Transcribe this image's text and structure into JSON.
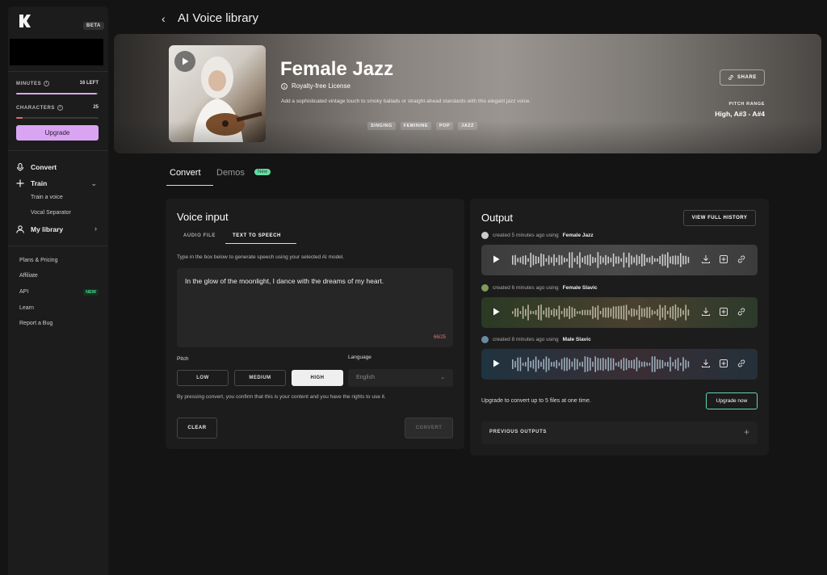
{
  "sidebar": {
    "beta": "BETA",
    "minutes": {
      "label": "MINUTES",
      "value": "16 LEFT",
      "fraction": 0.98
    },
    "characters": {
      "label": "CHARACTERS",
      "value": "25",
      "fraction": 0.08
    },
    "upgrade": "Upgrade",
    "nav": [
      {
        "label": "Convert",
        "icon": "microphone-icon"
      },
      {
        "label": "Train",
        "icon": "plus-icon"
      },
      {
        "label": "My library",
        "icon": "user-icon"
      }
    ],
    "train_sub": [
      "Train a voice",
      "Vocal Separator"
    ],
    "links": [
      "Plans & Pricing",
      "Affiliate",
      "API",
      "Learn",
      "Report a Bug"
    ],
    "api_badge": "NEW"
  },
  "header": {
    "title": "AI Voice library"
  },
  "hero": {
    "name": "Female Jazz",
    "license": "Royalty-free License",
    "description": "Add a sophisticated vintage touch to smoky ballads or straight-ahead standards with this elegant jazz voice.",
    "tags": [
      "SINGING",
      "FEMININE",
      "POP",
      "JAZZ"
    ],
    "share": "SHARE",
    "pitch_range_label": "PITCH RANGE",
    "pitch_range": "High, A#3 - A#4"
  },
  "tabs": {
    "convert": "Convert",
    "demos": "Demos",
    "demos_badge": "New"
  },
  "voice_input": {
    "title": "Voice input",
    "tabs": [
      "AUDIO FILE",
      "TEXT TO SPEECH"
    ],
    "hint": "Type in the box below to generate speech using your selected AI model.",
    "text": "In the glow of the moonlight, I dance with the dreams of my heart.",
    "counter": "66/25",
    "pitch_label": "Pitch",
    "pitch_options": [
      "LOW",
      "MEDIUM",
      "HIGH"
    ],
    "language_label": "Language",
    "language_value": "English",
    "consent": "By pressing convert, you confirm that this is your content and you have the rights to use it.",
    "clear": "CLEAR",
    "convert": "CONVERT"
  },
  "output": {
    "title": "Output",
    "history_button": "VIEW FULL HISTORY",
    "items": [
      {
        "meta": "created 5 minutes ago using",
        "voice": "Female Jazz",
        "bg": "#3a3a3a"
      },
      {
        "meta": "created 6 minutes ago using",
        "voice": "Female Slavic",
        "bg": "#2e3a2a"
      },
      {
        "meta": "created 8 minutes ago using",
        "voice": "Male Slavic",
        "bg": "#233038"
      }
    ],
    "upsell": "Upgrade to convert up to 5 files at one time.",
    "upgrade_now": "Upgrade now",
    "previous": "PREVIOUS OUTPUTS"
  }
}
